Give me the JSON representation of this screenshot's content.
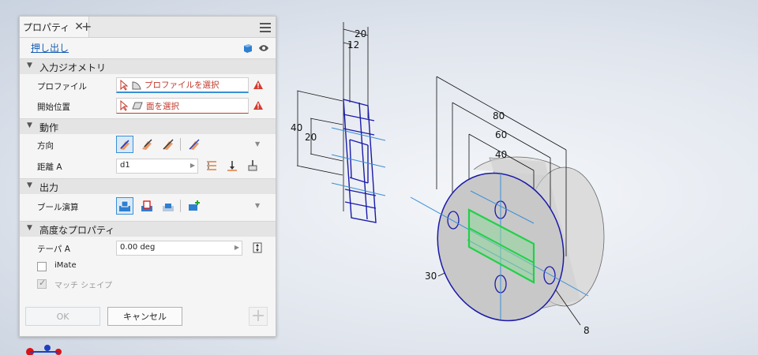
{
  "panel": {
    "tab_title": "プロパティ",
    "feature_name": "押し出し",
    "sections": {
      "input_geometry": "入力ジオメトリ",
      "behavior": "動作",
      "output": "出力",
      "advanced": "高度なプロパティ"
    },
    "profile": {
      "label": "プロファイル",
      "value": "プロファイルを選択"
    },
    "start": {
      "label": "開始位置",
      "value": "面を選択"
    },
    "direction": {
      "label": "方向"
    },
    "distance": {
      "label": "距離 A",
      "value": "d1"
    },
    "boolean": {
      "label": "ブール演算"
    },
    "taper": {
      "label": "テーパ A",
      "value": "0.00 deg"
    },
    "imate": {
      "label": "iMate",
      "checked": false
    },
    "match_shape": {
      "label": "マッチ シェイプ",
      "checked": true
    },
    "ok_label": "OK",
    "cancel_label": "キャンセル"
  },
  "viewport": {
    "dimensions": {
      "d20_top": "20",
      "d12": "12",
      "d40_left": "40",
      "d20_left": "20",
      "d80": "80",
      "d60": "60",
      "d40": "40",
      "d30": "30",
      "d8": "8"
    }
  },
  "colors": {
    "accent": "#3a8fd6",
    "warning": "#c0392b",
    "sketch": "#1a1aa8",
    "profile_green": "#22d04a"
  }
}
